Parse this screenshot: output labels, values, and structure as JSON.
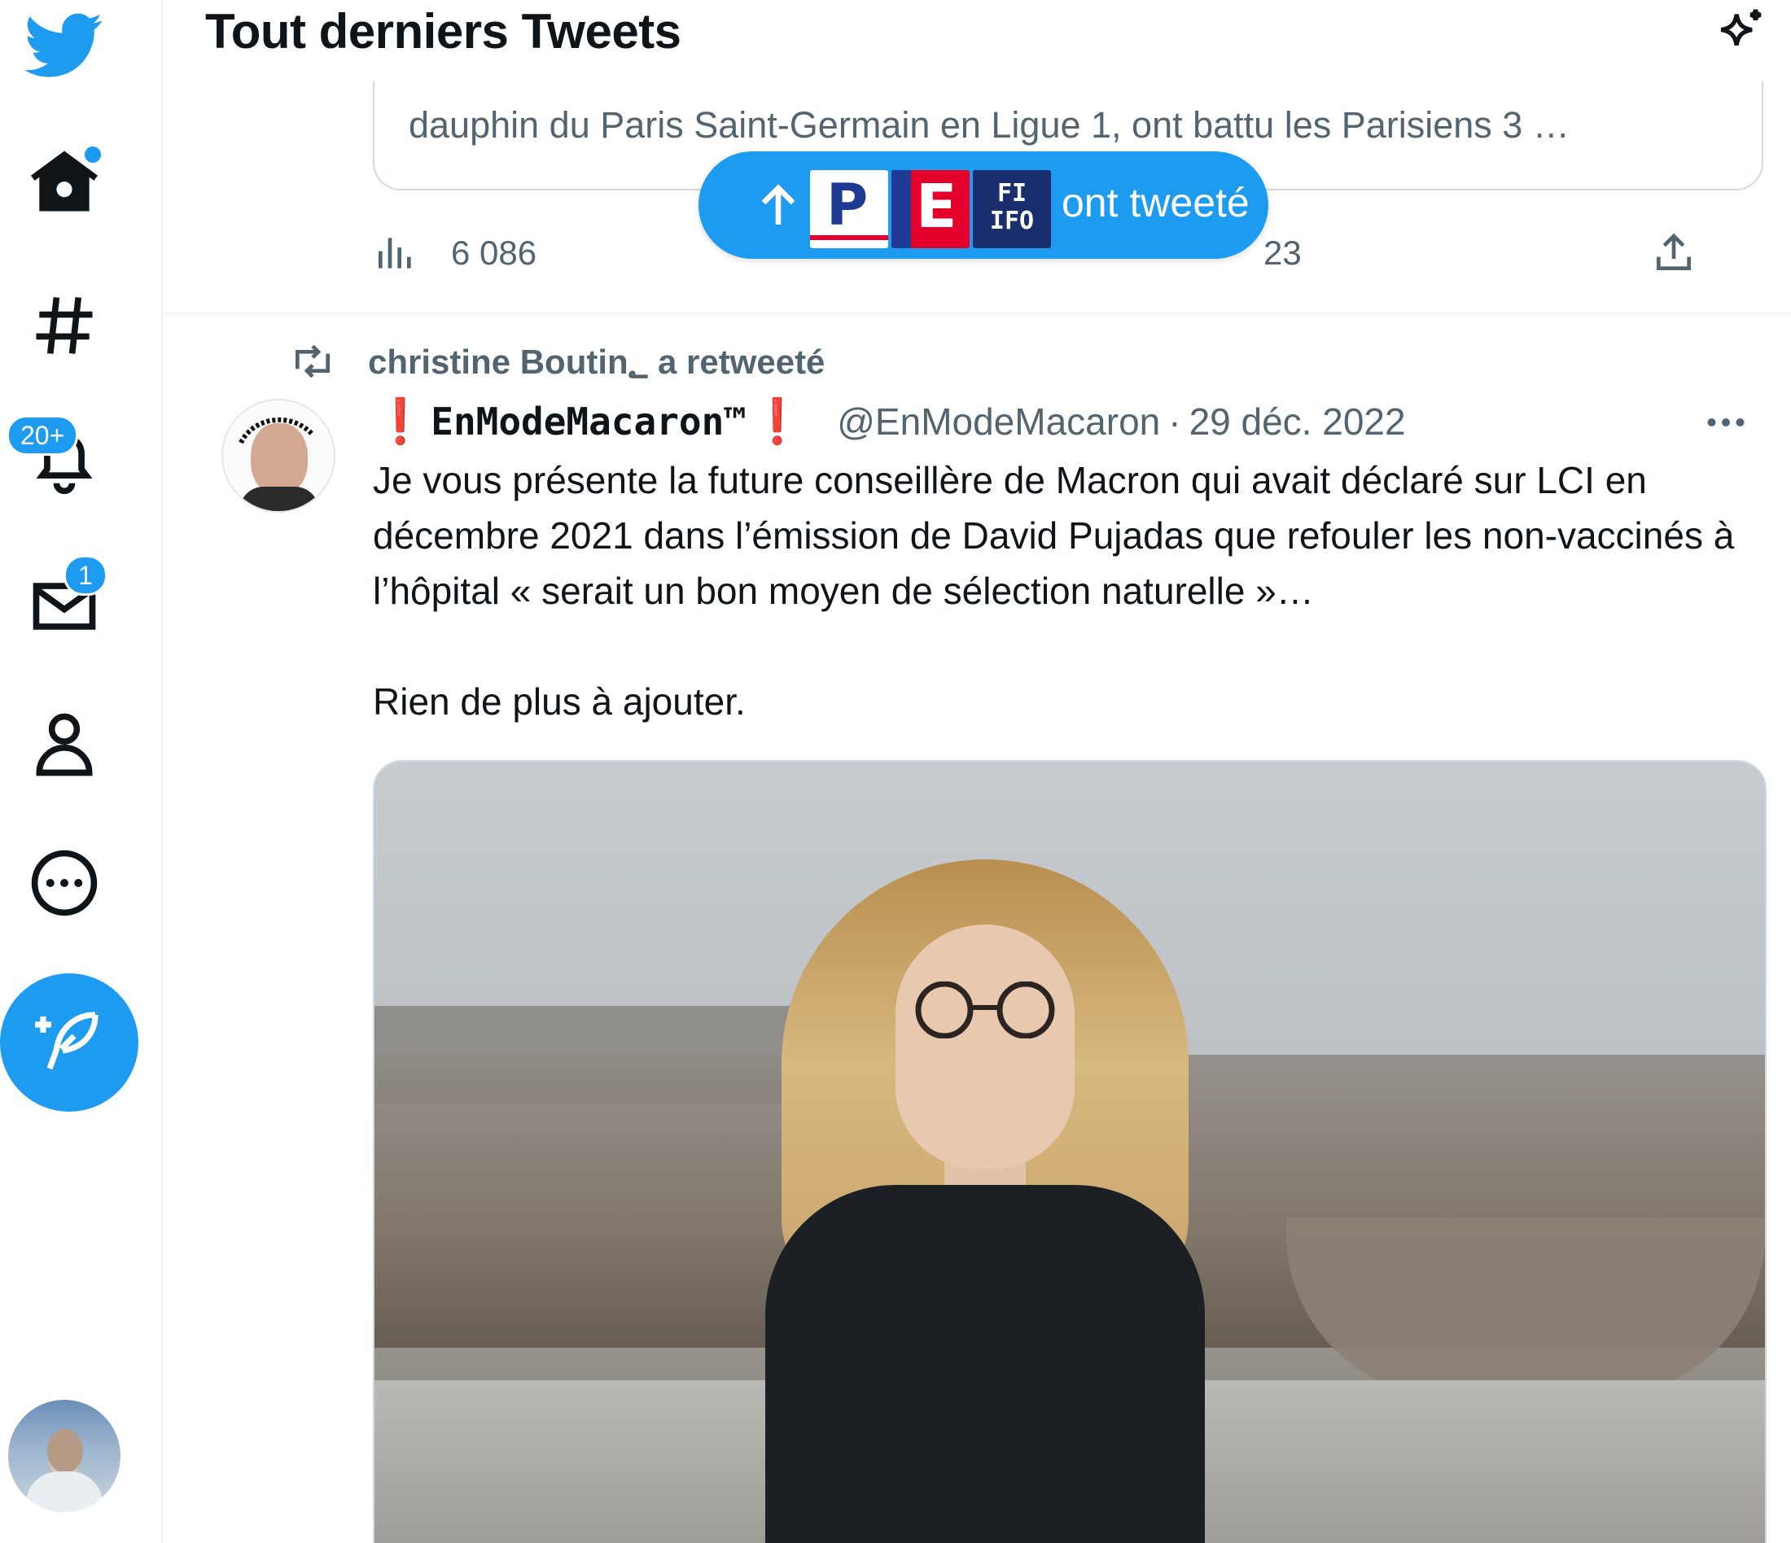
{
  "nav": {
    "badges": {
      "notifications": "20+",
      "messages": "1"
    }
  },
  "header": {
    "title": "Tout derniers Tweets"
  },
  "previous_tweet": {
    "card_description": "dauphin du Paris Saint-Germain en Ligue 1, ont battu les Parisiens 3 …",
    "views": "6 086",
    "likes": "23"
  },
  "new_tweets_pill": {
    "label": "ont tweeté"
  },
  "tweet": {
    "retweet_context": "christine Boutin؂ a retweeté",
    "display_name": "EnModeMacaron™",
    "bang_left": "❗",
    "bang_right": "❗",
    "handle": "@EnModeMacaron",
    "separator": "·",
    "date": "29 déc. 2022",
    "text_p1": "Je vous présente la future conseillère de Macron qui avait déclaré sur LCI en décembre 2021 dans l’émission de David Pujadas que refouler les non-vaccinés à l’hôpital « serait un bon moyen de sélection naturelle »…",
    "text_p2": "Rien de plus à ajouter."
  },
  "colors": {
    "accent": "#1d9bf0",
    "text": "#0f1419",
    "muted": "#536471",
    "border": "#cfd9de"
  },
  "icons": [
    "twitter-logo-icon",
    "home-icon",
    "hashtag-icon",
    "bell-icon",
    "mail-icon",
    "person-icon",
    "more-circle-icon",
    "compose-feather-icon",
    "sparkle-icon",
    "views-icon",
    "share-icon",
    "retweet-icon",
    "more-dots-icon",
    "arrow-up-icon"
  ]
}
